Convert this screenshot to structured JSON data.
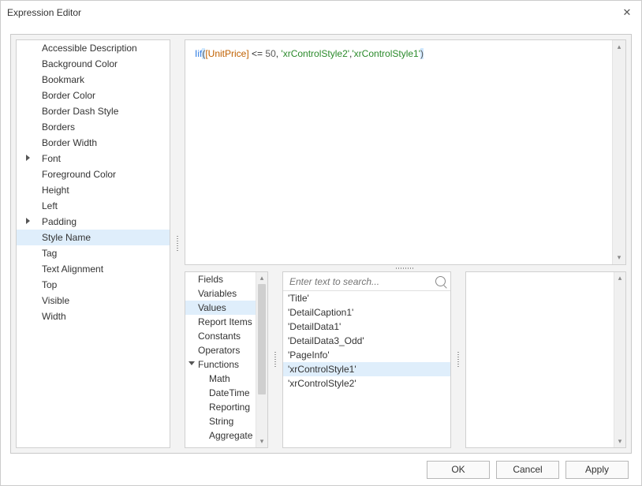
{
  "window": {
    "title": "Expression Editor"
  },
  "expression_tokens": [
    {
      "t": "Iif",
      "c": "kw"
    },
    {
      "t": "(",
      "c": "paren-hi"
    },
    {
      "t": "[UnitPrice]",
      "c": "field"
    },
    {
      "t": " <= ",
      "c": ""
    },
    {
      "t": "50",
      "c": "num"
    },
    {
      "t": ", ",
      "c": ""
    },
    {
      "t": "'xrControlStyle2'",
      "c": "str"
    },
    {
      "t": ",",
      "c": ""
    },
    {
      "t": "'xrControlStyle1'",
      "c": "str"
    },
    {
      "t": ")",
      "c": "paren-hi"
    }
  ],
  "properties": [
    {
      "label": "Accessible Description",
      "expandable": false,
      "selected": false
    },
    {
      "label": "Background Color",
      "expandable": false,
      "selected": false
    },
    {
      "label": "Bookmark",
      "expandable": false,
      "selected": false
    },
    {
      "label": "Border Color",
      "expandable": false,
      "selected": false
    },
    {
      "label": "Border Dash Style",
      "expandable": false,
      "selected": false
    },
    {
      "label": "Borders",
      "expandable": false,
      "selected": false
    },
    {
      "label": "Border Width",
      "expandable": false,
      "selected": false
    },
    {
      "label": "Font",
      "expandable": true,
      "selected": false
    },
    {
      "label": "Foreground Color",
      "expandable": false,
      "selected": false
    },
    {
      "label": "Height",
      "expandable": false,
      "selected": false
    },
    {
      "label": "Left",
      "expandable": false,
      "selected": false
    },
    {
      "label": "Padding",
      "expandable": true,
      "selected": false
    },
    {
      "label": "Style Name",
      "expandable": false,
      "selected": true
    },
    {
      "label": "Tag",
      "expandable": false,
      "selected": false
    },
    {
      "label": "Text Alignment",
      "expandable": false,
      "selected": false
    },
    {
      "label": "Top",
      "expandable": false,
      "selected": false
    },
    {
      "label": "Visible",
      "expandable": false,
      "selected": false
    },
    {
      "label": "Width",
      "expandable": false,
      "selected": false
    }
  ],
  "categories": [
    {
      "label": "Fields",
      "sub": false,
      "selected": false,
      "expandable": false
    },
    {
      "label": "Variables",
      "sub": false,
      "selected": false,
      "expandable": false
    },
    {
      "label": "Values",
      "sub": false,
      "selected": true,
      "expandable": false
    },
    {
      "label": "Report Items",
      "sub": false,
      "selected": false,
      "expandable": false
    },
    {
      "label": "Constants",
      "sub": false,
      "selected": false,
      "expandable": false
    },
    {
      "label": "Operators",
      "sub": false,
      "selected": false,
      "expandable": false
    },
    {
      "label": "Functions",
      "sub": false,
      "selected": false,
      "expandable": true
    },
    {
      "label": "Math",
      "sub": true,
      "selected": false,
      "expandable": false
    },
    {
      "label": "DateTime",
      "sub": true,
      "selected": false,
      "expandable": false
    },
    {
      "label": "Reporting",
      "sub": true,
      "selected": false,
      "expandable": false
    },
    {
      "label": "String",
      "sub": true,
      "selected": false,
      "expandable": false
    },
    {
      "label": "Aggregate",
      "sub": true,
      "selected": false,
      "expandable": false
    }
  ],
  "search": {
    "placeholder": "Enter text to search..."
  },
  "values": [
    {
      "label": "'Title'",
      "selected": false
    },
    {
      "label": "'DetailCaption1'",
      "selected": false
    },
    {
      "label": "'DetailData1'",
      "selected": false
    },
    {
      "label": "'DetailData3_Odd'",
      "selected": false
    },
    {
      "label": "'PageInfo'",
      "selected": false
    },
    {
      "label": "'xrControlStyle1'",
      "selected": true
    },
    {
      "label": "'xrControlStyle2'",
      "selected": false
    }
  ],
  "buttons": {
    "ok": "OK",
    "cancel": "Cancel",
    "apply": "Apply"
  }
}
